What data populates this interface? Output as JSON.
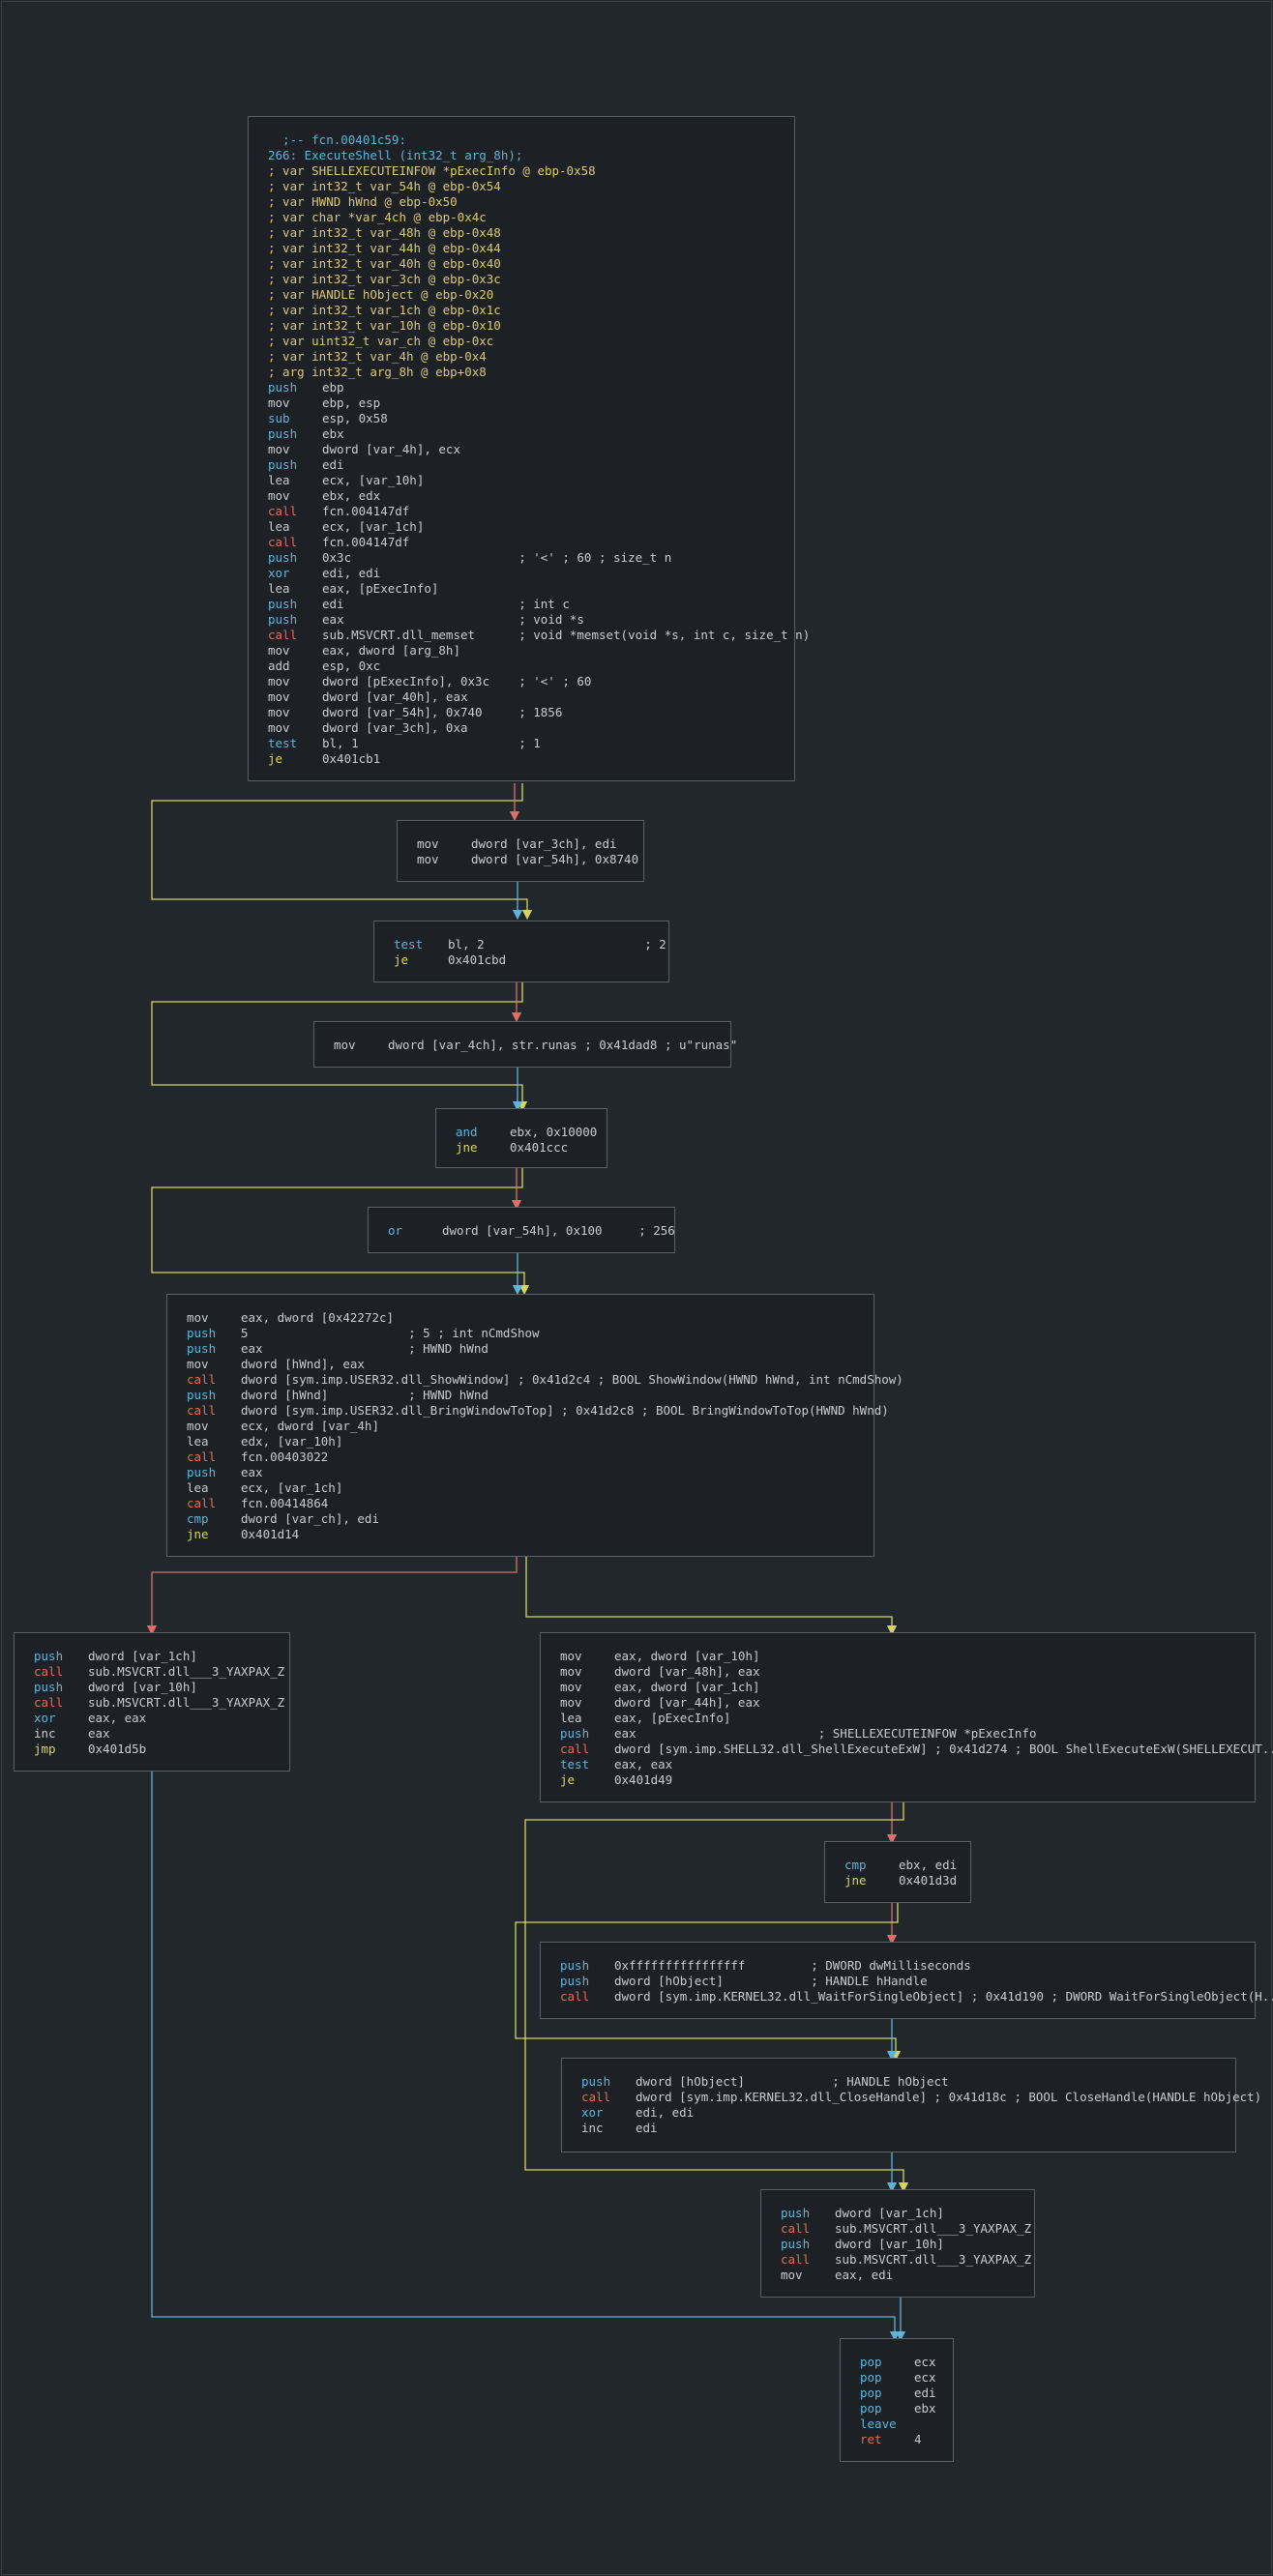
{
  "colors": {
    "background": "#22272b",
    "node_bg": "#1d2125",
    "node_border": "#5a6066",
    "edge_true": "#d6d65e",
    "edge_false": "#e06c6c",
    "edge_uncond": "#5fb3d9"
  },
  "blocks": {
    "b0": {
      "header": [
        "  ;-- fcn.00401c59:",
        "266: ExecuteShell (int32_t arg_8h);",
        "; var SHELLEXECUTEINFOW *pExecInfo @ ebp-0x58",
        "; var int32_t var_54h @ ebp-0x54",
        "; var HWND hWnd @ ebp-0x50",
        "; var char *var_4ch @ ebp-0x4c",
        "; var int32_t var_48h @ ebp-0x48",
        "; var int32_t var_44h @ ebp-0x44",
        "; var int32_t var_40h @ ebp-0x40",
        "; var int32_t var_3ch @ ebp-0x3c",
        "; var HANDLE hObject @ ebp-0x20",
        "; var int32_t var_1ch @ ebp-0x1c",
        "; var int32_t var_10h @ ebp-0x10",
        "; var uint32_t var_ch @ ebp-0xc",
        "; var int32_t var_4h @ ebp-0x4",
        "; arg int32_t arg_8h @ ebp+0x8"
      ],
      "ops": [
        {
          "m": "push",
          "a": "ebp"
        },
        {
          "m": "mov",
          "a": "ebp, esp"
        },
        {
          "m": "sub",
          "a": "esp, 0x58"
        },
        {
          "m": "push",
          "a": "ebx"
        },
        {
          "m": "mov",
          "a": "dword [var_4h], ecx"
        },
        {
          "m": "push",
          "a": "edi"
        },
        {
          "m": "lea",
          "a": "ecx, [var_10h]"
        },
        {
          "m": "mov",
          "a": "ebx, edx"
        },
        {
          "m": "call",
          "a": "fcn.004147df"
        },
        {
          "m": "lea",
          "a": "ecx, [var_1ch]"
        },
        {
          "m": "call",
          "a": "fcn.004147df"
        },
        {
          "m": "push",
          "a": "0x3c                       ; '<' ; 60 ; size_t n"
        },
        {
          "m": "xor",
          "a": "edi, edi"
        },
        {
          "m": "lea",
          "a": "eax, [pExecInfo]"
        },
        {
          "m": "push",
          "a": "edi                        ; int c"
        },
        {
          "m": "push",
          "a": "eax                        ; void *s"
        },
        {
          "m": "call",
          "a": "sub.MSVCRT.dll_memset      ; void *memset(void *s, int c, size_t n)"
        },
        {
          "m": "mov",
          "a": "eax, dword [arg_8h]"
        },
        {
          "m": "add",
          "a": "esp, 0xc"
        },
        {
          "m": "mov",
          "a": "dword [pExecInfo], 0x3c    ; '<' ; 60"
        },
        {
          "m": "mov",
          "a": "dword [var_40h], eax"
        },
        {
          "m": "mov",
          "a": "dword [var_54h], 0x740     ; 1856"
        },
        {
          "m": "mov",
          "a": "dword [var_3ch], 0xa"
        },
        {
          "m": "test",
          "a": "bl, 1                      ; 1"
        },
        {
          "m": "je",
          "a": "0x401cb1"
        }
      ]
    },
    "b1": {
      "ops": [
        {
          "m": "mov",
          "a": "dword [var_3ch], edi"
        },
        {
          "m": "mov",
          "a": "dword [var_54h], 0x8740"
        }
      ]
    },
    "b2": {
      "ops": [
        {
          "m": "test",
          "a": "bl, 2                      ; 2"
        },
        {
          "m": "je",
          "a": "0x401cbd"
        }
      ]
    },
    "b3": {
      "ops": [
        {
          "m": "mov",
          "a": "dword [var_4ch], str.runas ; 0x41dad8 ; u\"runas\""
        }
      ]
    },
    "b4": {
      "ops": [
        {
          "m": "and",
          "a": "ebx, 0x10000"
        },
        {
          "m": "jne",
          "a": "0x401ccc"
        }
      ]
    },
    "b5": {
      "ops": [
        {
          "m": "or",
          "a": "dword [var_54h], 0x100     ; 256"
        }
      ]
    },
    "b6": {
      "ops": [
        {
          "m": "mov",
          "a": "eax, dword [0x42272c]"
        },
        {
          "m": "push",
          "a": "5                      ; 5 ; int nCmdShow"
        },
        {
          "m": "push",
          "a": "eax                    ; HWND hWnd"
        },
        {
          "m": "mov",
          "a": "dword [hWnd], eax"
        },
        {
          "m": "call",
          "a": "dword [sym.imp.USER32.dll_ShowWindow] ; 0x41d2c4 ; BOOL ShowWindow(HWND hWnd, int nCmdShow)"
        },
        {
          "m": "push",
          "a": "dword [hWnd]           ; HWND hWnd"
        },
        {
          "m": "call",
          "a": "dword [sym.imp.USER32.dll_BringWindowToTop] ; 0x41d2c8 ; BOOL BringWindowToTop(HWND hWnd)"
        },
        {
          "m": "mov",
          "a": "ecx, dword [var_4h]"
        },
        {
          "m": "lea",
          "a": "edx, [var_10h]"
        },
        {
          "m": "call",
          "a": "fcn.00403022"
        },
        {
          "m": "push",
          "a": "eax"
        },
        {
          "m": "lea",
          "a": "ecx, [var_1ch]"
        },
        {
          "m": "call",
          "a": "fcn.00414864"
        },
        {
          "m": "cmp",
          "a": "dword [var_ch], edi"
        },
        {
          "m": "jne",
          "a": "0x401d14"
        }
      ]
    },
    "b7": {
      "ops": [
        {
          "m": "push",
          "a": "dword [var_1ch]"
        },
        {
          "m": "call",
          "a": "sub.MSVCRT.dll___3_YAXPAX_Z"
        },
        {
          "m": "push",
          "a": "dword [var_10h]"
        },
        {
          "m": "call",
          "a": "sub.MSVCRT.dll___3_YAXPAX_Z"
        },
        {
          "m": "xor",
          "a": "eax, eax"
        },
        {
          "m": "inc",
          "a": "eax"
        },
        {
          "m": "jmp",
          "a": "0x401d5b"
        }
      ]
    },
    "b8": {
      "ops": [
        {
          "m": "mov",
          "a": "eax, dword [var_10h]"
        },
        {
          "m": "mov",
          "a": "dword [var_48h], eax"
        },
        {
          "m": "mov",
          "a": "eax, dword [var_1ch]"
        },
        {
          "m": "mov",
          "a": "dword [var_44h], eax"
        },
        {
          "m": "lea",
          "a": "eax, [pExecInfo]"
        },
        {
          "m": "push",
          "a": "eax                         ; SHELLEXECUTEINFOW *pExecInfo"
        },
        {
          "m": "call",
          "a": "dword [sym.imp.SHELL32.dll_ShellExecuteExW] ; 0x41d274 ; BOOL ShellExecuteExW(SHELLEXECUT..."
        },
        {
          "m": "test",
          "a": "eax, eax"
        },
        {
          "m": "je",
          "a": "0x401d49"
        }
      ]
    },
    "b9": {
      "ops": [
        {
          "m": "cmp",
          "a": "ebx, edi"
        },
        {
          "m": "jne",
          "a": "0x401d3d"
        }
      ]
    },
    "b10": {
      "ops": [
        {
          "m": "push",
          "a": "0xffffffffffffffff         ; DWORD dwMilliseconds"
        },
        {
          "m": "push",
          "a": "dword [hObject]            ; HANDLE hHandle"
        },
        {
          "m": "call",
          "a": "dword [sym.imp.KERNEL32.dll_WaitForSingleObject] ; 0x41d190 ; DWORD WaitForSingleObject(H..."
        }
      ]
    },
    "b11": {
      "ops": [
        {
          "m": "push",
          "a": "dword [hObject]            ; HANDLE hObject"
        },
        {
          "m": "call",
          "a": "dword [sym.imp.KERNEL32.dll_CloseHandle] ; 0x41d18c ; BOOL CloseHandle(HANDLE hObject)"
        },
        {
          "m": "xor",
          "a": "edi, edi"
        },
        {
          "m": "inc",
          "a": "edi"
        }
      ]
    },
    "b12": {
      "ops": [
        {
          "m": "push",
          "a": "dword [var_1ch]"
        },
        {
          "m": "call",
          "a": "sub.MSVCRT.dll___3_YAXPAX_Z"
        },
        {
          "m": "push",
          "a": "dword [var_10h]"
        },
        {
          "m": "call",
          "a": "sub.MSVCRT.dll___3_YAXPAX_Z"
        },
        {
          "m": "mov",
          "a": "eax, edi"
        }
      ]
    },
    "b13": {
      "ops": [
        {
          "m": "pop",
          "a": "ecx"
        },
        {
          "m": "pop",
          "a": "ecx"
        },
        {
          "m": "pop",
          "a": "edi"
        },
        {
          "m": "pop",
          "a": "ebx"
        },
        {
          "m": "leave",
          "a": ""
        },
        {
          "m": "ret",
          "a": "4"
        }
      ]
    }
  }
}
